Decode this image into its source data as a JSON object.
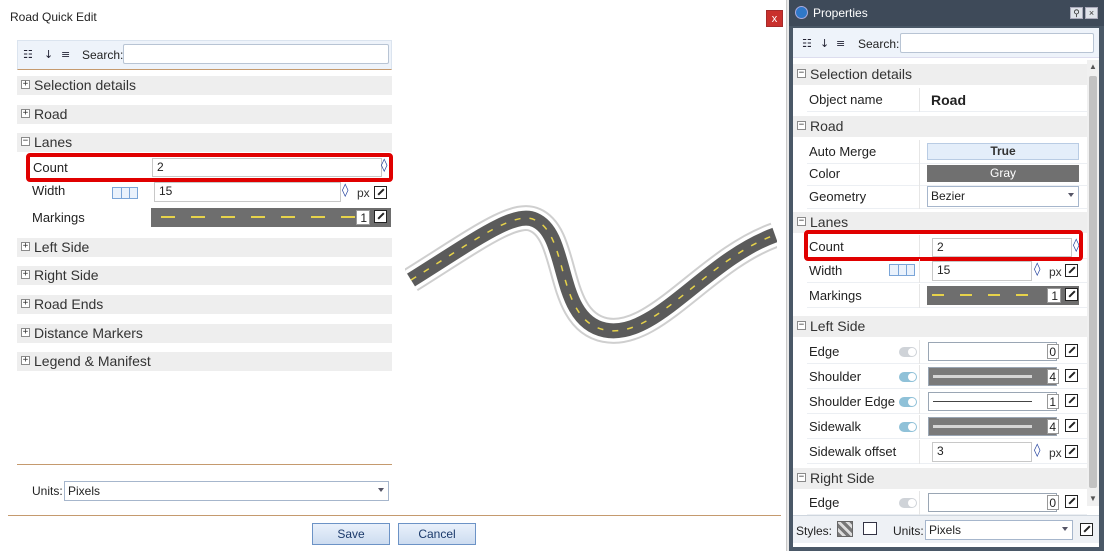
{
  "dialog": {
    "title": "Road Quick Edit",
    "close_label": "x",
    "search_label": "Search:",
    "search_value": "",
    "categories": {
      "selection_details": "Selection details",
      "road": "Road",
      "lanes": "Lanes",
      "left_side": "Left Side",
      "right_side": "Right Side",
      "road_ends": "Road Ends",
      "distance_markers": "Distance Markers",
      "legend_manifest": "Legend & Manifest"
    },
    "lanes": {
      "count_label": "Count",
      "count_value": "2",
      "width_label": "Width",
      "width_value": "15",
      "width_unit": "px",
      "markings_label": "Markings",
      "markings_value": "1"
    },
    "units_label": "Units:",
    "units_value": "Pixels",
    "save_label": "Save",
    "cancel_label": "Cancel"
  },
  "properties": {
    "title": "Properties",
    "search_label": "Search:",
    "categories": {
      "selection_details": "Selection details",
      "road": "Road",
      "lanes": "Lanes",
      "left_side": "Left Side",
      "right_side": "Right Side"
    },
    "object_name_label": "Object name",
    "object_name_value": "Road",
    "auto_merge_label": "Auto Merge",
    "auto_merge_value": "True",
    "color_label": "Color",
    "color_value": "Gray",
    "geometry_label": "Geometry",
    "geometry_value": "Bezier",
    "count_label": "Count",
    "count_value": "2",
    "width_label": "Width",
    "width_value": "15",
    "width_unit": "px",
    "markings_label": "Markings",
    "markings_value": "1",
    "edge_label": "Edge",
    "edge_value": "0",
    "shoulder_label": "Shoulder",
    "shoulder_value": "4",
    "shoulder_edge_label": "Shoulder Edge",
    "shoulder_edge_value": "1",
    "sidewalk_label": "Sidewalk",
    "sidewalk_value": "4",
    "sidewalk_offset_label": "Sidewalk offset",
    "sidewalk_offset_value": "3",
    "sidewalk_offset_unit": "px",
    "right_edge_label": "Edge",
    "right_edge_value": "0",
    "styles_label": "Styles:",
    "units_label": "Units:",
    "units_value": "Pixels"
  },
  "colors": {
    "highlight": "#e00000",
    "panel_header": "#3e4a59",
    "road_marking": "#e6d24a"
  }
}
